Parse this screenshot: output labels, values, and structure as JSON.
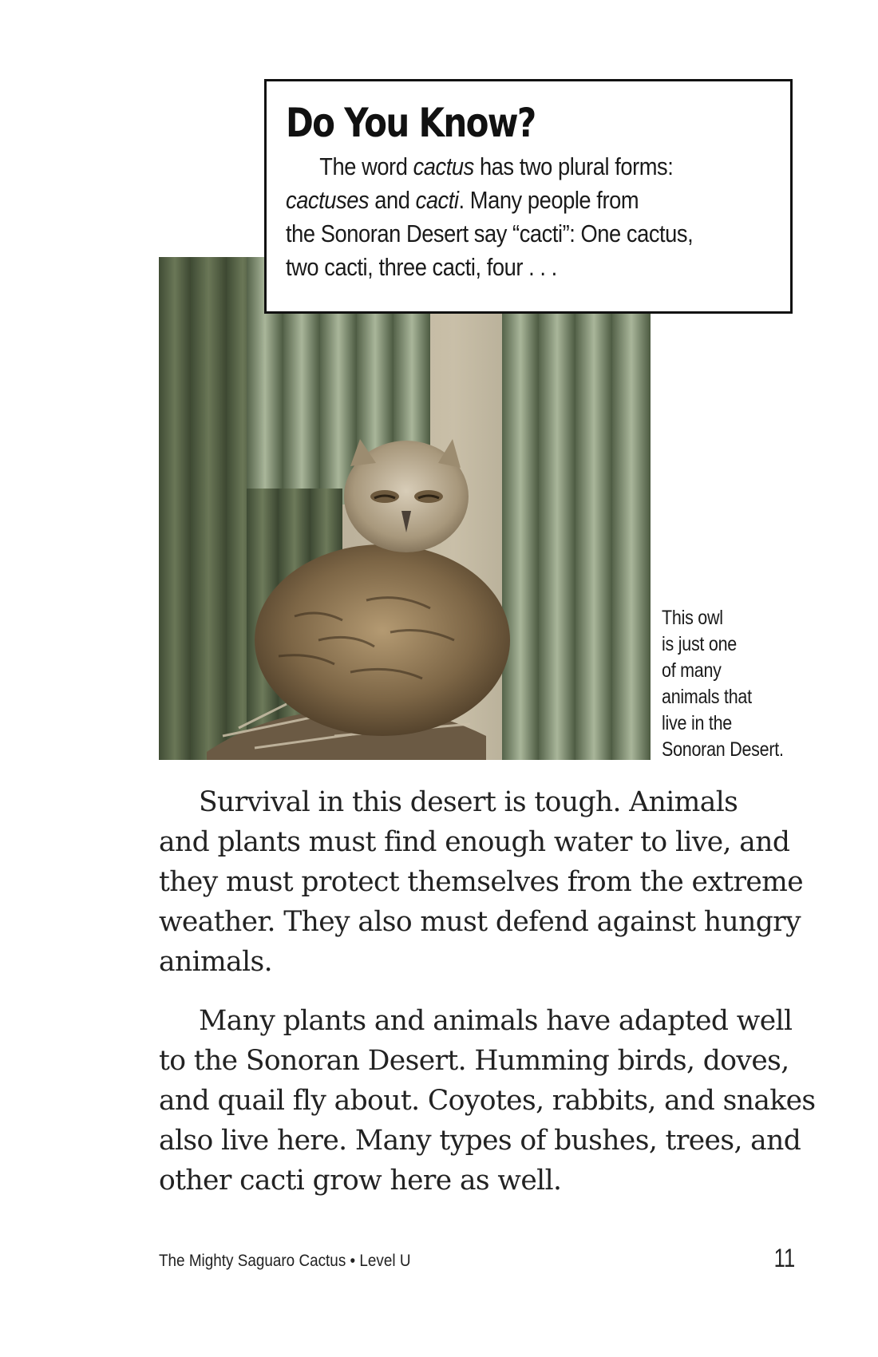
{
  "sidebar": {
    "title": "Do You Know?",
    "lines": [
      [
        "The word ",
        "cactus",
        " has two plural forms:"
      ],
      [
        "",
        "cactuses",
        " and "
      ],
      [
        "the Sonoran Desert say “cacti”: One cactus,"
      ],
      [
        "two cacti, three cacti, four . . ."
      ]
    ],
    "line1_pre": "The word ",
    "line1_em": "cactus",
    "line1_post": " has two plural forms:",
    "line2_em1": "cactuses",
    "line2_mid": " and ",
    "line2_em2": "cacti",
    "line2_post": ". Many people from",
    "line3": "the Sonoran Desert say “cacti”: One cactus,",
    "line4": "two cacti, three cacti, four . . ."
  },
  "caption": {
    "lines": [
      "This owl",
      "is just one",
      "of many",
      "animals that",
      "live in the",
      "Sonoran Desert."
    ]
  },
  "body": {
    "paragraph1": [
      "Survival in this desert is tough. Animals",
      "and plants must find enough water to live, and",
      "they must protect themselves from the extreme",
      "weather. They also must defend against hungry",
      "animals."
    ],
    "paragraph2": [
      "Many plants and animals have adapted well",
      "to the Sonoran Desert. Humming birds, doves,",
      "and quail fly about. Coyotes, rabbits, and snakes",
      "also live here.  Many types of bushes, trees, and",
      "other cacti grow here as well."
    ]
  },
  "footer": {
    "book_title": "The Mighty Saguaro Cactus • Level U",
    "page_number": "11"
  },
  "photo": {
    "subject": "owl-among-saguaro-cacti"
  }
}
